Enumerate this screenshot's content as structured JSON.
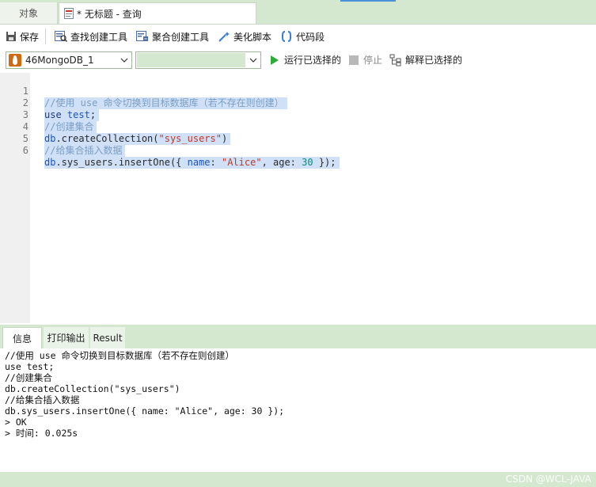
{
  "tabs": {
    "objects": "对象",
    "query": "* 无标题 - 查询"
  },
  "toolbar": {
    "save": "保存",
    "find_builder": "查找创建工具",
    "aggregate_builder": "聚合创建工具",
    "beautify": "美化脚本",
    "snippet": "代码段"
  },
  "connection": {
    "selected": "46MongoDB_1",
    "database": "",
    "run_selected": "运行已选择的",
    "stop": "停止",
    "explain_selected": "解释已选择的"
  },
  "editor": {
    "line_numbers": [
      "1",
      "2",
      "3",
      "4",
      "5",
      "6"
    ],
    "line1": "//使用 use 命令切换到目标数据库（若不存在则创建）",
    "line2_kw": "use",
    "line2_id": "test",
    "line2_end": ";",
    "line3": "//创建集合",
    "line4_obj": "db",
    "line4_fn": ".createCollection(",
    "line4_str": "\"sys_users\"",
    "line4_end": ")",
    "line5": "//给集合插入数据",
    "line6_obj": "db",
    "line6_fn": ".sys_users.insertOne({ ",
    "line6_key1": "name",
    "line6_colon1": ": ",
    "line6_str": "\"Alice\"",
    "line6_mid": ", age: ",
    "line6_num": "30",
    "line6_end": " });"
  },
  "panel_tabs": {
    "info": "信息",
    "print": "打印输出",
    "result": "Result"
  },
  "output": {
    "lines": [
      "//使用 use 命令切换到目标数据库（若不存在则创建）",
      "use test;",
      "//创建集合",
      "db.createCollection(\"sys_users\")",
      "//给集合插入数据",
      "db.sys_users.insertOne({ name: \"Alice\", age: 30 });",
      "> OK",
      "> 时间: 0.025s"
    ]
  },
  "watermark": "CSDN @WCL-JAVA",
  "colors": {
    "accent_green": "#d4e8d0",
    "selection": "#cfe0f7",
    "comment": "#7a9ec4",
    "string": "#c0392b"
  }
}
